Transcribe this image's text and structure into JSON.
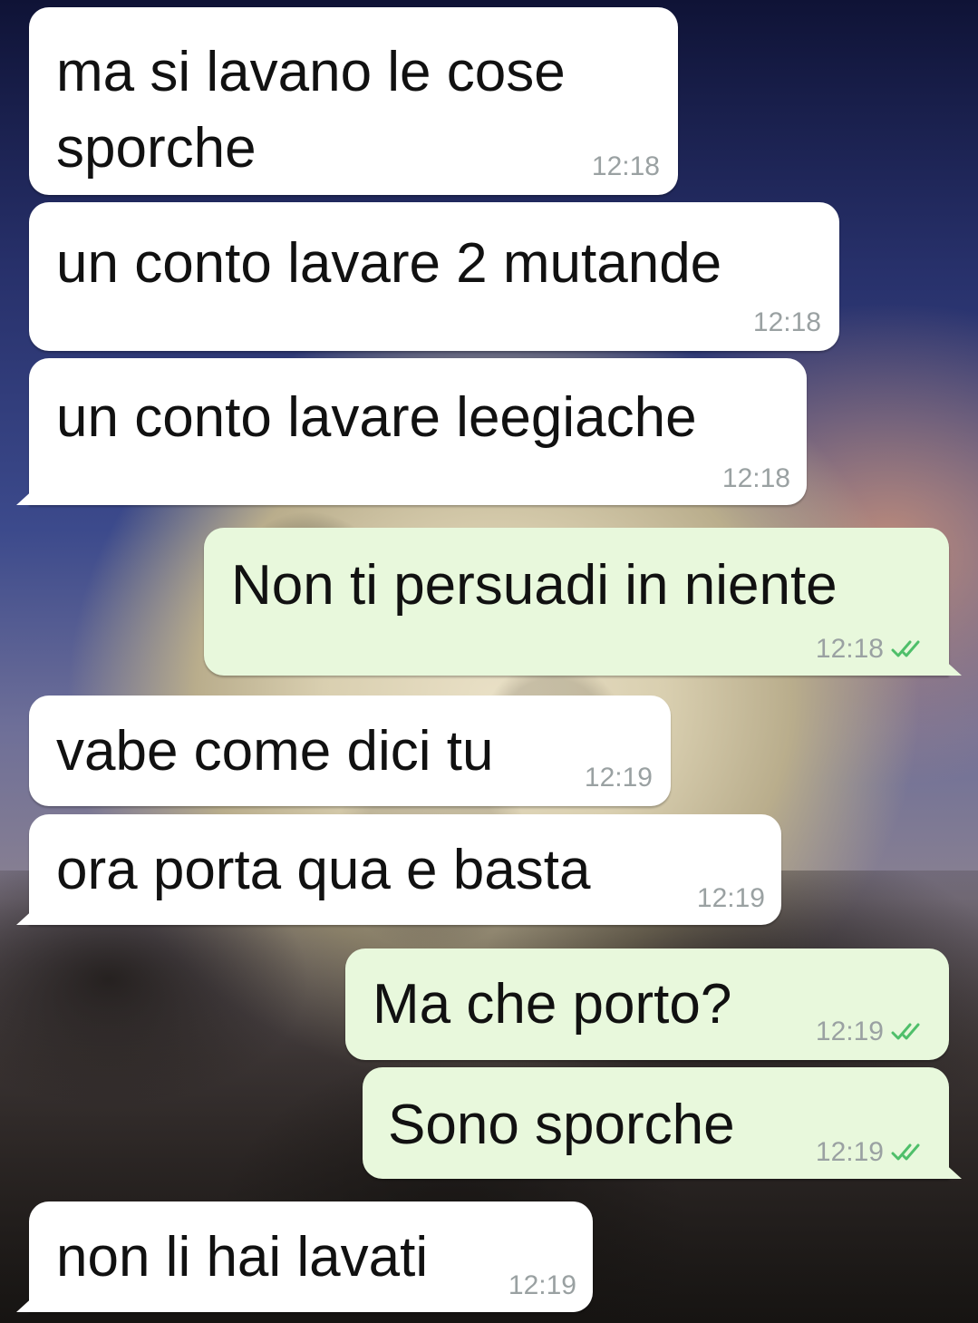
{
  "wallpaper": "full-moon-night-sky",
  "colors": {
    "incoming_bubble": "#ffffff",
    "outgoing_bubble": "#e8f8dc",
    "timestamp": "#9aa1a2",
    "read_ticks": "#4fbf6a"
  },
  "messages": [
    {
      "direction": "in",
      "text": "ma si lavano le cose\nsporche",
      "time": "12:18"
    },
    {
      "direction": "in",
      "text": "un conto lavare 2 mutande",
      "time": "12:18"
    },
    {
      "direction": "in",
      "text": "un conto lavare leegiache",
      "time": "12:18"
    },
    {
      "direction": "out",
      "text": "Non ti persuadi in niente",
      "time": "12:18",
      "status_icon": "double-check-icon"
    },
    {
      "direction": "in",
      "text": "vabe come dici tu",
      "time": "12:19"
    },
    {
      "direction": "in",
      "text": "ora porta qua e basta",
      "time": "12:19"
    },
    {
      "direction": "out",
      "text": "Ma che porto?",
      "time": "12:19",
      "status_icon": "double-check-icon"
    },
    {
      "direction": "out",
      "text": "Sono sporche",
      "time": "12:19",
      "status_icon": "double-check-icon"
    },
    {
      "direction": "in",
      "text": "non li hai lavati",
      "time": "12:19"
    }
  ]
}
